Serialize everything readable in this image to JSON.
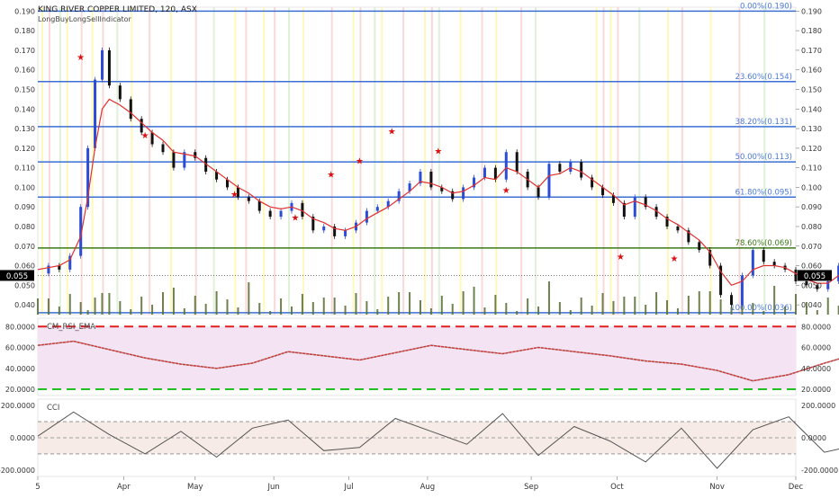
{
  "header": {
    "title": "KING RIVER COPPER LIMITED, 120, ASX",
    "indicator": "LongBuyLongSellIndicator"
  },
  "colors": {
    "candle_up": "#2a4cd6",
    "candle_down": "#111111",
    "ema_fast": "#e03030",
    "ema_slow": "#3cc24a",
    "fib_line": "#3b6fd4",
    "fib_label": "#4a7ad8",
    "fib_786": "#3a7a1a",
    "rsi_band": "#f3e3f3",
    "rsi_line": "#d63030",
    "rsi_raw": "#aaaaaa",
    "rsi_upper": "#e02020",
    "rsi_lower": "#22c022",
    "cci_line": "#555555",
    "cci_band": "#f6ebe6",
    "volume": "#556b2f",
    "price_badge": "#000000"
  },
  "chart_data": [
    {
      "type": "line",
      "title": "KING RIVER COPPER LIMITED, 120, ASX",
      "ylim": [
        0.035,
        0.192
      ],
      "yticks": [
        0.04,
        0.05,
        0.06,
        0.07,
        0.08,
        0.09,
        0.1,
        0.11,
        0.12,
        0.13,
        0.14,
        0.15,
        0.16,
        0.17,
        0.18,
        0.19
      ],
      "ytick_labels": [
        "0.040",
        "0.050",
        "0.060",
        "0.070",
        "0.080",
        "0.090",
        "0.100",
        "0.110",
        "0.120",
        "0.130",
        "0.140",
        "0.150",
        "0.160",
        "0.170",
        "0.180",
        "0.190"
      ],
      "last_price_label": "0.055",
      "last_price": 0.055,
      "fib_levels": [
        {
          "value": 0.19,
          "label": "0.00%(0.190)"
        },
        {
          "value": 0.154,
          "label": "23.60%(0.154)"
        },
        {
          "value": 0.131,
          "label": "38.20%(0.131)"
        },
        {
          "value": 0.113,
          "label": "50.00%(0.113)"
        },
        {
          "value": 0.095,
          "label": "61.80%(0.095)"
        },
        {
          "value": 0.069,
          "label": "78.60%(0.069)"
        },
        {
          "value": 0.036,
          "label": "100.00%(0.036)"
        }
      ],
      "price_path_x": [
        0,
        3,
        6,
        9,
        12,
        14,
        16,
        18,
        20,
        23,
        26,
        29,
        32,
        35,
        38,
        41,
        44,
        47,
        50,
        53,
        56,
        59,
        62,
        65,
        68,
        71,
        74,
        77,
        80,
        83,
        86,
        89,
        92,
        95,
        98,
        101,
        104,
        107,
        110,
        113,
        116,
        119,
        122,
        125,
        128,
        131,
        134,
        137,
        140,
        143,
        146,
        149,
        152,
        155,
        158,
        161,
        164,
        167,
        170,
        173,
        176,
        179,
        182,
        185,
        188,
        191,
        194,
        197,
        200,
        203,
        206,
        209,
        212,
        215,
        218,
        221,
        224,
        227,
        230,
        233,
        236,
        239,
        242,
        245,
        248,
        251,
        254,
        257,
        260
      ],
      "price_path_y": [
        0.056,
        0.06,
        0.058,
        0.065,
        0.09,
        0.12,
        0.155,
        0.17,
        0.152,
        0.145,
        0.135,
        0.128,
        0.122,
        0.118,
        0.11,
        0.118,
        0.115,
        0.108,
        0.104,
        0.1,
        0.095,
        0.093,
        0.088,
        0.085,
        0.088,
        0.092,
        0.085,
        0.078,
        0.08,
        0.075,
        0.078,
        0.082,
        0.088,
        0.09,
        0.093,
        0.098,
        0.102,
        0.108,
        0.1,
        0.098,
        0.094,
        0.1,
        0.105,
        0.11,
        0.104,
        0.118,
        0.108,
        0.1,
        0.095,
        0.112,
        0.108,
        0.113,
        0.105,
        0.1,
        0.096,
        0.092,
        0.085,
        0.095,
        0.09,
        0.085,
        0.08,
        0.078,
        0.072,
        0.068,
        0.06,
        0.045,
        0.04,
        0.055,
        0.068,
        0.062,
        0.06,
        0.058,
        0.052,
        0.05,
        0.048,
        0.052,
        0.06,
        0.058,
        0.057,
        0.055,
        0.055,
        0.055,
        0.055,
        0.055,
        0.055,
        0.055,
        0.055,
        0.055,
        0.055
      ],
      "ema_path_y": [
        0.058,
        0.059,
        0.06,
        0.063,
        0.075,
        0.095,
        0.12,
        0.14,
        0.145,
        0.142,
        0.138,
        0.133,
        0.128,
        0.124,
        0.118,
        0.117,
        0.116,
        0.112,
        0.108,
        0.104,
        0.1,
        0.097,
        0.093,
        0.09,
        0.089,
        0.09,
        0.088,
        0.084,
        0.082,
        0.079,
        0.078,
        0.08,
        0.084,
        0.087,
        0.09,
        0.094,
        0.098,
        0.103,
        0.102,
        0.1,
        0.097,
        0.098,
        0.101,
        0.105,
        0.104,
        0.11,
        0.108,
        0.104,
        0.1,
        0.106,
        0.107,
        0.11,
        0.108,
        0.104,
        0.1,
        0.096,
        0.091,
        0.093,
        0.091,
        0.088,
        0.084,
        0.081,
        0.077,
        0.073,
        0.067,
        0.057,
        0.05,
        0.052,
        0.058,
        0.06,
        0.06,
        0.059,
        0.056,
        0.053,
        0.051,
        0.051,
        0.055,
        0.056,
        0.056,
        0.056,
        0.056,
        0.056,
        0.056,
        0.056,
        0.056,
        0.056,
        0.056,
        0.056,
        0.056
      ]
    },
    {
      "type": "line",
      "title": "CM_RSI_EMA",
      "ylim": [
        14,
        88
      ],
      "yticks": [
        20,
        40,
        60,
        80
      ],
      "ytick_labels": [
        "20.0000",
        "40.0000",
        "60.0000",
        "80.0000"
      ],
      "upper": 80,
      "lower": 20,
      "band": [
        20,
        80
      ],
      "x": [
        0,
        10,
        20,
        30,
        40,
        50,
        60,
        70,
        80,
        90,
        100,
        110,
        120,
        130,
        140,
        150,
        160,
        170,
        180,
        190,
        200,
        210,
        220,
        230,
        240,
        250,
        260
      ],
      "values": [
        62,
        66,
        58,
        50,
        44,
        40,
        45,
        56,
        52,
        48,
        55,
        62,
        58,
        54,
        60,
        56,
        52,
        47,
        44,
        38,
        28,
        34,
        45,
        55,
        42,
        50,
        48
      ]
    },
    {
      "type": "line",
      "title": "CCI",
      "ylim": [
        -240,
        240
      ],
      "yticks": [
        -200,
        0,
        200
      ],
      "ytick_labels": [
        "-200.0000",
        "0.0000",
        "200.0000"
      ],
      "band": [
        -100,
        100
      ],
      "x": [
        0,
        10,
        20,
        30,
        40,
        50,
        60,
        70,
        80,
        90,
        100,
        110,
        120,
        130,
        140,
        150,
        160,
        170,
        180,
        190,
        200,
        210,
        220,
        230,
        240,
        250,
        260
      ],
      "values": [
        10,
        160,
        20,
        -100,
        40,
        -120,
        60,
        110,
        -80,
        -60,
        120,
        40,
        -40,
        150,
        -110,
        70,
        -20,
        -150,
        60,
        -190,
        50,
        130,
        -90,
        -40,
        -120,
        120,
        0
      ]
    }
  ],
  "time_axis": {
    "labels": [
      "5",
      "Apr",
      "May",
      "Jun",
      "Jul",
      "Aug",
      "Sep",
      "Oct",
      "Nov",
      "Dec"
    ],
    "positions": [
      0,
      24,
      44,
      66,
      87,
      109,
      138,
      162,
      190,
      212
    ]
  }
}
